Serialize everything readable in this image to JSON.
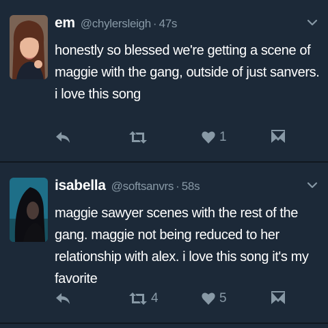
{
  "tweets": [
    {
      "name": "em",
      "handle": "@chylersleigh",
      "separator": "·",
      "time": "47s",
      "text": "honestly so blessed we're getting a scene of maggie with the gang, outside of just sanvers. i love this song",
      "reply_count": "",
      "retweet_count": "",
      "like_count": "1",
      "avatar_icon": "woman-portrait-avatar"
    },
    {
      "name": "isabella",
      "handle": "@softsanvrs",
      "separator": "·",
      "time": "58s",
      "text": "maggie sawyer scenes with the rest of the gang. maggie not being reduced to her relationship with alex. i love this song it's my favorite",
      "reply_count": "",
      "retweet_count": "4",
      "like_count": "5",
      "avatar_icon": "dark-haired-person-avatar"
    }
  ],
  "icons": {
    "reply": "reply-icon",
    "retweet": "retweet-icon",
    "like": "heart-icon",
    "dm": "direct-message-icon",
    "menu": "chevron-down-icon"
  },
  "colors": {
    "background": "#1c2938",
    "divider": "#10171e",
    "secondary_text": "#8899a6",
    "primary_text": "#ffffff"
  }
}
